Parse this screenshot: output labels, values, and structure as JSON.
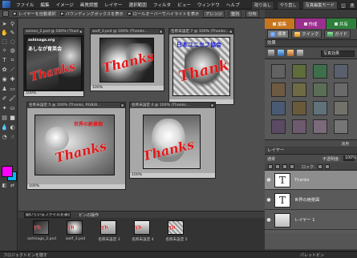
{
  "menubar": {
    "items": [
      "ファイル",
      "編集",
      "イメージ",
      "画質調整",
      "レイヤー",
      "選択範囲",
      "フィルタ",
      "ビュー",
      "ウィンドウ",
      "ヘルプ"
    ],
    "undo_label": "取り消し",
    "redo_label": "やり直し",
    "mode_label": "写真編集モード",
    "win_min": "_",
    "win_close": "X"
  },
  "options": {
    "auto_select_layer": "レイヤーを自動選択",
    "show_bounding_box": "バウンディングボックスを表示",
    "highlight_rollover": "ロールオーバーでハイライトを表示",
    "arrange": "アレンジ",
    "align": "整列",
    "distribute": "分布"
  },
  "right_tabs": {
    "edit": "編集",
    "create": "作成",
    "share": "共有"
  },
  "sub_tabs": {
    "full": "標準",
    "quick": "クイック",
    "guided": "ガイド"
  },
  "effects": {
    "title": "効果",
    "category": "写真効果",
    "apply": "適用",
    "swatch_colors": [
      "#626262",
      "#5f6d3a",
      "#3d6f4a",
      "#5a5f6e",
      "#6e5a42",
      "#6e6a44",
      "#5a6e56",
      "#6a6a6a",
      "#4a5a72",
      "#6a5a3a",
      "#62727a",
      "#72726a",
      "#5a4a62",
      "#6e5a6e",
      "#7a6a7a",
      "#767676"
    ]
  },
  "layers": {
    "title": "レイヤー",
    "blend_mode": "通常",
    "opacity_label": "不透明度:",
    "opacity_value": "100%",
    "lock_label": "ロック:",
    "rows": [
      {
        "thumb": "T",
        "name": "Thanks",
        "selected": true
      },
      {
        "thumb": "T",
        "name": "世界の絶景図",
        "selected": false
      },
      {
        "thumb": "",
        "name": "レイヤー 1",
        "selected": false
      }
    ]
  },
  "documents": [
    {
      "title": "asineo_2.psd @ 100% (Thanks...",
      "zoom": "100%",
      "overlay_jp": "あしなが育英会",
      "overlay_url": "ashinaga.org",
      "thanks": "Thanks"
    },
    {
      "title": "wolf_3.psd @ 100% (Thanks...",
      "zoom": "100%",
      "thanks": "Thanks"
    },
    {
      "title": "名称未設定 7 @ 100% (Thanks...",
      "zoom": "",
      "overlay_jp": "日本ユニセフ協会",
      "thanks": "Thanks"
    },
    {
      "title": "名称未設定 5 @ 100% (Thanks, RGB/8...",
      "zoom": "100%",
      "overlay_jp": "世界の絶景図",
      "thanks": "Thanks"
    },
    {
      "title": "名称未設定 4 @ 100% (Thanks...",
      "zoom": "100%",
      "thanks": "Thanks"
    }
  ],
  "bin": {
    "dropdown": "開いているファイルを表示",
    "operation": "ビンの操作",
    "items": [
      "ashinaga_2.psd",
      "wolf_3.psd",
      "名称未設定 3",
      "名称未設定 4",
      "名称未設定 5"
    ]
  },
  "status": {
    "left": "フロジェクトビンを隠す",
    "right": "パレットビン"
  },
  "toolbox": {
    "fg_color": "#ff00ff",
    "bg_color": "#00b8ff"
  }
}
